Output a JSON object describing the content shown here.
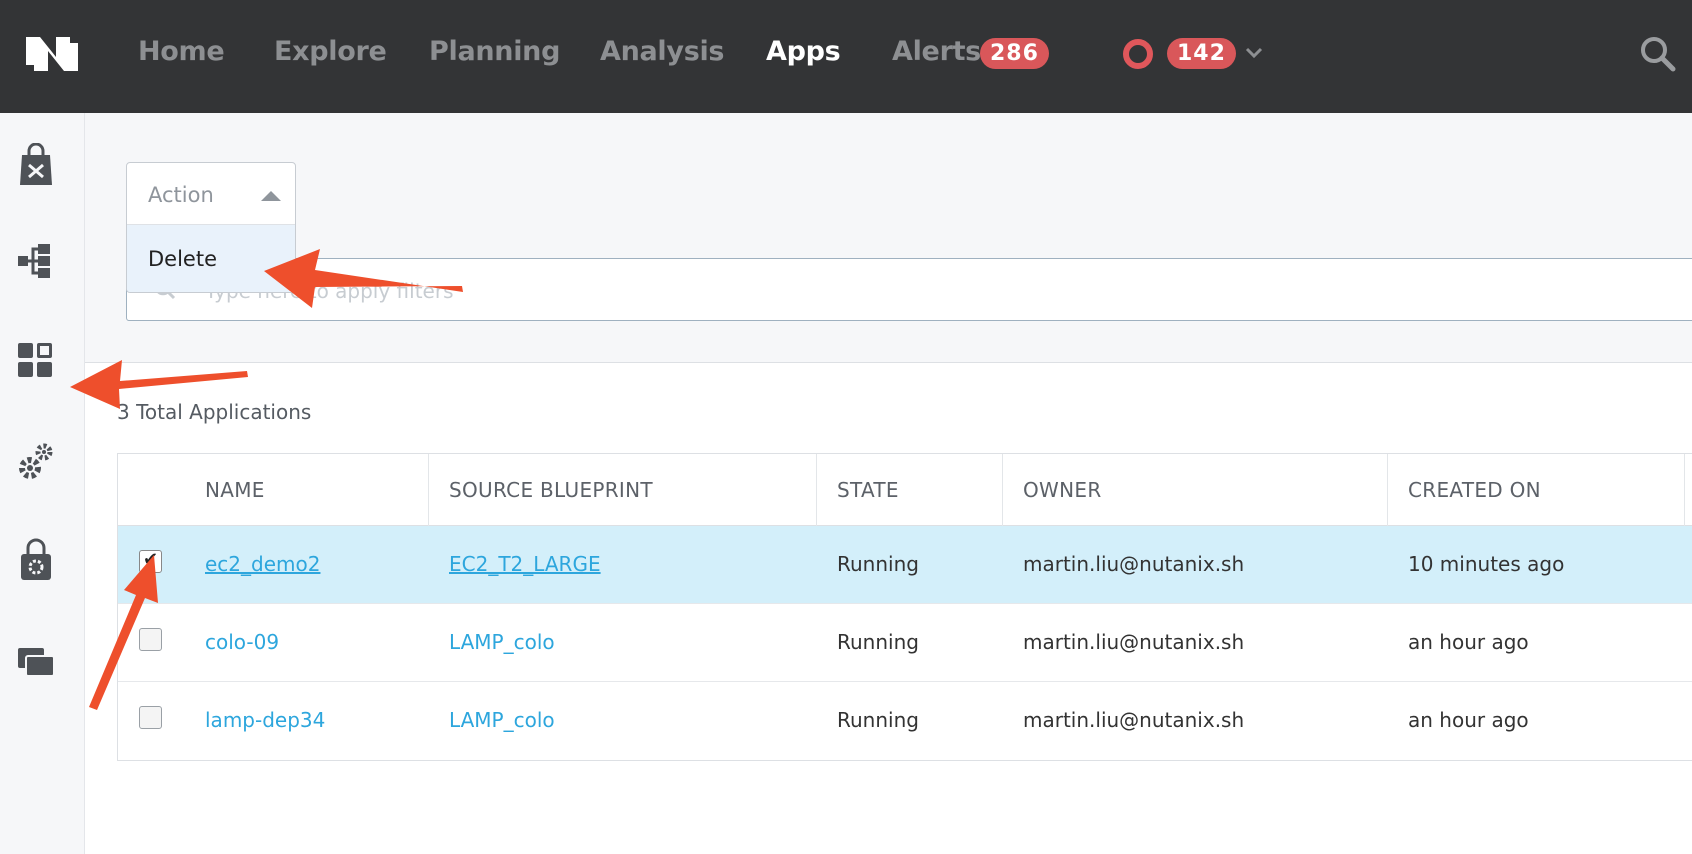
{
  "nav": {
    "items": [
      "Home",
      "Explore",
      "Planning",
      "Analysis",
      "Apps",
      "Alerts"
    ],
    "active": "Apps",
    "alerts_count": "286",
    "events_count": "142"
  },
  "sidebar": {
    "icons": [
      "marketplace-icon",
      "blueprints-icon",
      "applications-icon",
      "settings-icon",
      "projects-icon",
      "windows-icon"
    ]
  },
  "action": {
    "label": "Action",
    "option": "Delete"
  },
  "filter": {
    "placeholder": "Type here to apply filters"
  },
  "summary": "3 Total Applications",
  "table": {
    "columns": [
      "NAME",
      "SOURCE BLUEPRINT",
      "STATE",
      "OWNER",
      "CREATED ON"
    ],
    "rows": [
      {
        "name": "ec2_demo2",
        "blueprint": "EC2_T2_LARGE",
        "state": "Running",
        "owner": "martin.liu@nutanix.sh",
        "created": "10 minutes ago",
        "checked": true
      },
      {
        "name": "colo-09",
        "blueprint": "LAMP_colo",
        "state": "Running",
        "owner": "martin.liu@nutanix.sh",
        "created": "an hour ago",
        "checked": false
      },
      {
        "name": "lamp-dep34",
        "blueprint": "LAMP_colo",
        "state": "Running",
        "owner": "martin.liu@nutanix.sh",
        "created": "an hour ago",
        "checked": false
      }
    ]
  },
  "colors": {
    "topbar": "#333436",
    "badge": "#d9575a",
    "link": "#2da6dd",
    "selected_row": "#d3effa",
    "annotation_arrow": "#ee4f2c"
  }
}
